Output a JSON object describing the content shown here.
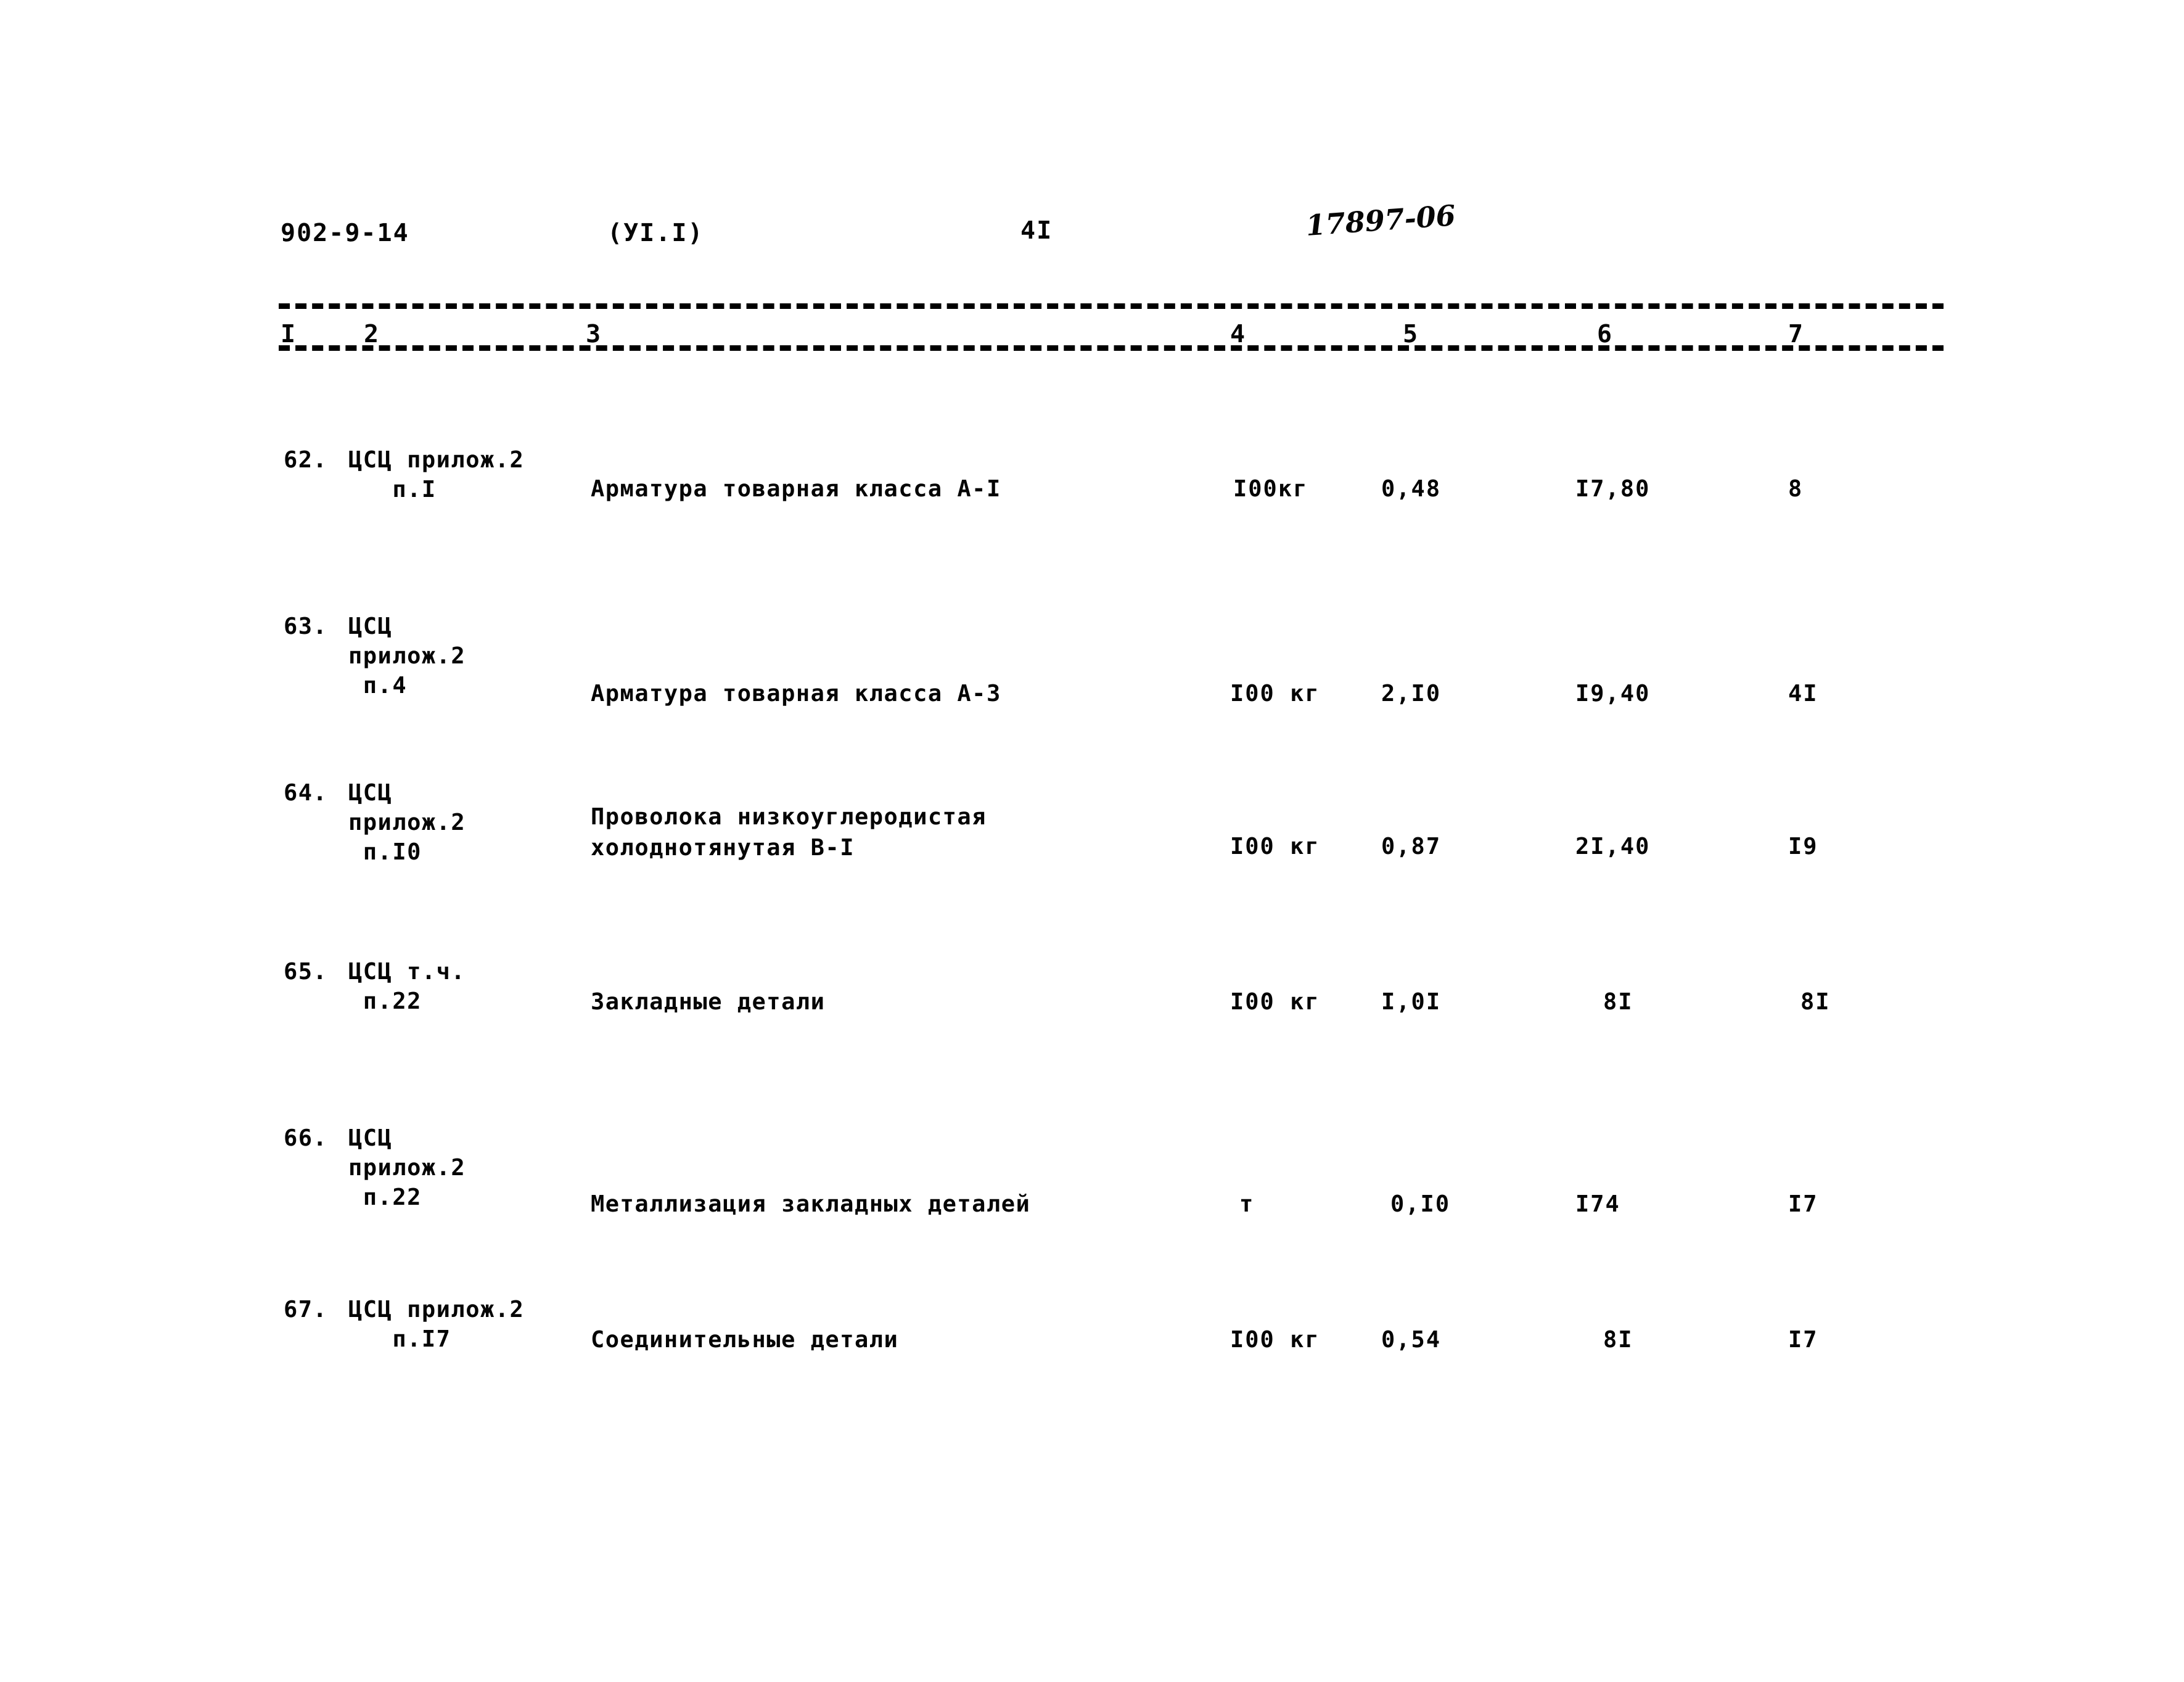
{
  "header": {
    "doc_number": "902-9-14",
    "section": "(УI.I)",
    "page_number": "4I",
    "stamp": "17897-06"
  },
  "table": {
    "column_numbers": [
      "I",
      "2",
      "3",
      "4",
      "5",
      "6",
      "7"
    ],
    "rows": [
      {
        "index": "62.",
        "code": "ЦСЦ прилож.2\n   п.I",
        "name": "Арматура товарная класса А-I",
        "unit": "I00кг",
        "qty": "0,48",
        "price": "I7,80",
        "total": "8"
      },
      {
        "index": "63.",
        "code": "ЦСЦ\nприлож.2\n п.4",
        "name": "Арматура товарная класса А-З",
        "unit": "I00 кг",
        "qty": "2,I0",
        "price": "I9,40",
        "total": "4I"
      },
      {
        "index": "64.",
        "code": "ЦСЦ\nприлож.2\n п.I0",
        "name": "Проволока низкоуглеродистая\nхолоднотянутая В-I",
        "unit": "I00 кг",
        "qty": "0,87",
        "price": "2I,40",
        "total": "I9"
      },
      {
        "index": "65.",
        "code": "ЦСЦ т.ч.\n п.22",
        "name": "Закладные детали",
        "unit": "I00 кг",
        "qty": "I,0I",
        "price": "8I",
        "total": "8I"
      },
      {
        "index": "66.",
        "code": "ЦСЦ\nприлож.2\n п.22",
        "name": "Металлизация закладных деталей",
        "unit": "т",
        "qty": "0,I0",
        "price": "I74",
        "total": "I7"
      },
      {
        "index": "67.",
        "code": "ЦСЦ прилож.2\n   п.I7",
        "name": "Соединительные детали",
        "unit": "I00 кг",
        "qty": "0,54",
        "price": "8I",
        "total": "I7"
      }
    ]
  }
}
